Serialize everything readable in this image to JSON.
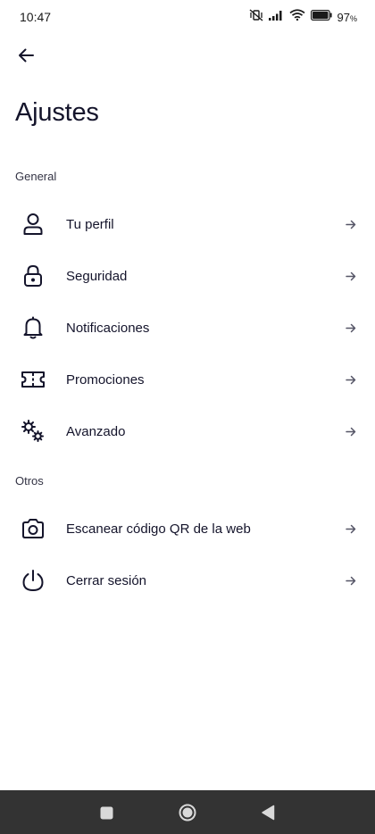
{
  "status_bar": {
    "time": "10:47",
    "battery_percent": "97",
    "battery_unit": "%",
    "icons": [
      "vibrate-mute-icon",
      "signal-icon",
      "wifi-icon",
      "battery-icon"
    ]
  },
  "header": {
    "back_icon": "arrow-left-icon",
    "title": "Ajustes"
  },
  "sections": {
    "general": {
      "label": "General",
      "items": [
        {
          "label": "Tu perfil",
          "icon": "user-icon"
        },
        {
          "label": "Seguridad",
          "icon": "lock-icon"
        },
        {
          "label": "Notificaciones",
          "icon": "bell-icon"
        },
        {
          "label": "Promociones",
          "icon": "ticket-icon"
        },
        {
          "label": "Avanzado",
          "icon": "gears-icon"
        }
      ]
    },
    "otros": {
      "label": "Otros",
      "items": [
        {
          "label": "Escanear código QR de la web",
          "icon": "camera-icon"
        },
        {
          "label": "Cerrar sesión",
          "icon": "power-icon"
        }
      ]
    }
  },
  "colors": {
    "text": "#14142b",
    "nav_bar": "#333333",
    "background": "#ffffff"
  }
}
